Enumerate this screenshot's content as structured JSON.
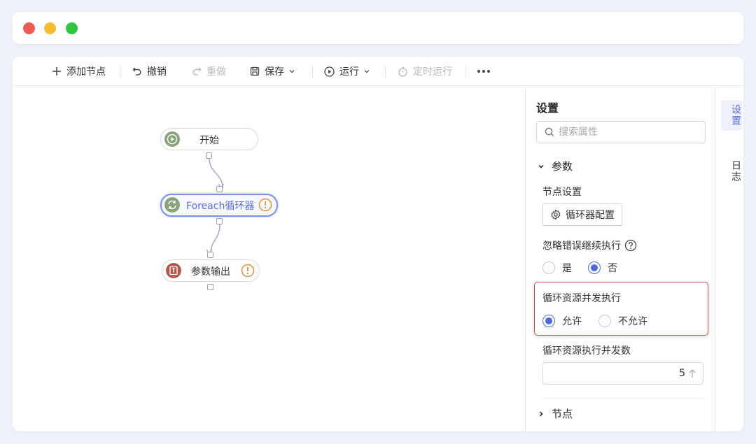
{
  "toolbar": {
    "add_node": "添加节点",
    "undo": "撤销",
    "redo": "重做",
    "save": "保存",
    "run": "运行",
    "scheduled_run": "定时运行"
  },
  "canvas": {
    "nodes": [
      {
        "label": "开始",
        "icon": "play-circle-icon"
      },
      {
        "label": "Foreach循环器",
        "icon": "loop-icon",
        "warning": true,
        "selected": true
      },
      {
        "label": "参数输出",
        "icon": "output-icon",
        "warning": true
      }
    ]
  },
  "settings": {
    "title": "设置",
    "search_placeholder": "搜索属性",
    "params_section": "参数",
    "node_settings_label": "节点设置",
    "loop_config_button": "循环器配置",
    "ignore_error_label": "忽略错误继续执行",
    "ignore_error_options": [
      "是",
      "否"
    ],
    "ignore_error_selected": "否",
    "concurrent_label": "循环资源并发执行",
    "concurrent_options": [
      "允许",
      "不允许"
    ],
    "concurrent_selected": "允许",
    "concurrency_count_label": "循环资源执行并发数",
    "concurrency_count_value": "5",
    "nodes_section": "节点"
  },
  "side_tabs": [
    "设置",
    "日志"
  ],
  "colors": {
    "accent": "#5b6fd9",
    "radio": "#4e68e0",
    "highlight_border": "#c74b4b",
    "warning": "#e0903a"
  }
}
